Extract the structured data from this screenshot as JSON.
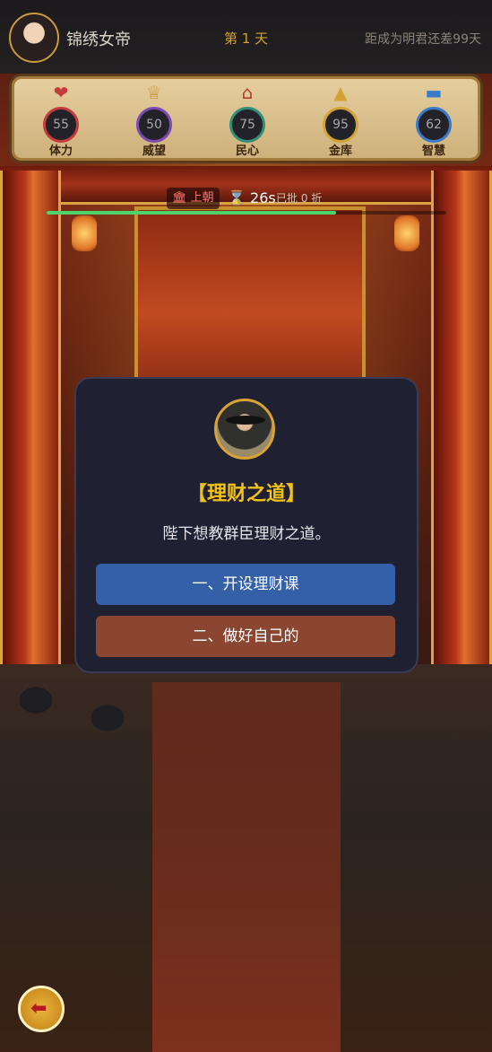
{
  "header": {
    "player_name": "锦绣女帝",
    "day": "第 1 天",
    "goal": "距成为明君还差99天"
  },
  "stats": [
    {
      "label": "体力",
      "value": "55",
      "icon": "heart-icon",
      "color": "#c53a3a"
    },
    {
      "label": "威望",
      "value": "50",
      "icon": "crown-icon",
      "color": "#7a4ab0"
    },
    {
      "label": "民心",
      "value": "75",
      "icon": "house-icon",
      "color": "#2f8f7a"
    },
    {
      "label": "金库",
      "value": "95",
      "icon": "gold-ingot-icon",
      "color": "#d2a334"
    },
    {
      "label": "智慧",
      "value": "62",
      "icon": "scroll-icon",
      "color": "#3a7ac8"
    }
  ],
  "status": {
    "court_label": "上朝",
    "timer": "26s",
    "approved": "已批 0 折",
    "progress": 0.725
  },
  "dialog": {
    "title": "【理财之道】",
    "description": "陛下想教群臣理财之道。",
    "options": [
      {
        "label": "一、开设理财课"
      },
      {
        "label": "二、做好自己的"
      }
    ]
  }
}
